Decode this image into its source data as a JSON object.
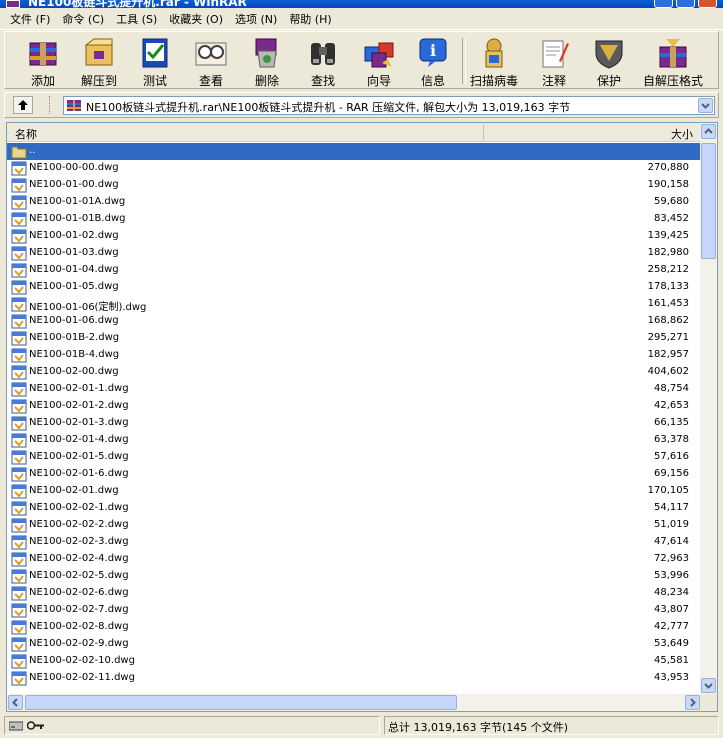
{
  "window": {
    "title": "NE100板链斗式提升机.rar - WinRAR"
  },
  "menu": [
    {
      "label": "文件 (F)"
    },
    {
      "label": "命令 (C)"
    },
    {
      "label": "工具 (S)"
    },
    {
      "label": "收藏夹 (O)"
    },
    {
      "label": "选项 (N)"
    },
    {
      "label": "帮助 (H)"
    }
  ],
  "toolbar": [
    {
      "label": "添加",
      "icon": "add-archive-icon"
    },
    {
      "label": "解压到",
      "icon": "extract-to-icon"
    },
    {
      "label": "测试",
      "icon": "test-icon"
    },
    {
      "label": "查看",
      "icon": "view-icon"
    },
    {
      "label": "删除",
      "icon": "delete-icon"
    },
    {
      "label": "查找",
      "icon": "find-icon"
    },
    {
      "label": "向导",
      "icon": "wizard-icon"
    },
    {
      "label": "信息",
      "icon": "info-icon"
    },
    {
      "label": "扫描病毒",
      "icon": "virus-scan-icon"
    },
    {
      "label": "注释",
      "icon": "comment-icon"
    },
    {
      "label": "保护",
      "icon": "protect-icon"
    },
    {
      "label": "自解压格式",
      "icon": "sfx-icon"
    }
  ],
  "address": {
    "path": "NE100板链斗式提升机.rar\\NE100板链斗式提升机 - RAR 压缩文件, 解包大小为 13,019,163 字节"
  },
  "columns": {
    "name": "名称",
    "size": "大小"
  },
  "parent_row": {
    "name": ".."
  },
  "files": [
    {
      "name": "NE100-00-00.dwg",
      "size": "270,880"
    },
    {
      "name": "NE100-01-00.dwg",
      "size": "190,158"
    },
    {
      "name": "NE100-01-01A.dwg",
      "size": "59,680"
    },
    {
      "name": "NE100-01-01B.dwg",
      "size": "83,452"
    },
    {
      "name": "NE100-01-02.dwg",
      "size": "139,425"
    },
    {
      "name": "NE100-01-03.dwg",
      "size": "182,980"
    },
    {
      "name": "NE100-01-04.dwg",
      "size": "258,212"
    },
    {
      "name": "NE100-01-05.dwg",
      "size": "178,133"
    },
    {
      "name": "NE100-01-06(定制).dwg",
      "size": "161,453"
    },
    {
      "name": "NE100-01-06.dwg",
      "size": "168,862"
    },
    {
      "name": "NE100-01B-2.dwg",
      "size": "295,271"
    },
    {
      "name": "NE100-01B-4.dwg",
      "size": "182,957"
    },
    {
      "name": "NE100-02-00.dwg",
      "size": "404,602"
    },
    {
      "name": "NE100-02-01-1.dwg",
      "size": "48,754"
    },
    {
      "name": "NE100-02-01-2.dwg",
      "size": "42,653"
    },
    {
      "name": "NE100-02-01-3.dwg",
      "size": "66,135"
    },
    {
      "name": "NE100-02-01-4.dwg",
      "size": "63,378"
    },
    {
      "name": "NE100-02-01-5.dwg",
      "size": "57,616"
    },
    {
      "name": "NE100-02-01-6.dwg",
      "size": "69,156"
    },
    {
      "name": "NE100-02-01.dwg",
      "size": "170,105"
    },
    {
      "name": "NE100-02-02-1.dwg",
      "size": "54,117"
    },
    {
      "name": "NE100-02-02-2.dwg",
      "size": "51,019"
    },
    {
      "name": "NE100-02-02-3.dwg",
      "size": "47,614"
    },
    {
      "name": "NE100-02-02-4.dwg",
      "size": "72,963"
    },
    {
      "name": "NE100-02-02-5.dwg",
      "size": "53,996"
    },
    {
      "name": "NE100-02-02-6.dwg",
      "size": "48,234"
    },
    {
      "name": "NE100-02-02-7.dwg",
      "size": "43,807"
    },
    {
      "name": "NE100-02-02-8.dwg",
      "size": "42,777"
    },
    {
      "name": "NE100-02-02-9.dwg",
      "size": "53,649"
    },
    {
      "name": "NE100-02-02-10.dwg",
      "size": "45,581"
    },
    {
      "name": "NE100-02-02-11.dwg",
      "size": "43,953"
    }
  ],
  "status": {
    "summary": "总计 13,019,163 字节(145 个文件)"
  },
  "colors": {
    "selection": "#316ac5",
    "titlebar": "#0a5fd8",
    "window_bg": "#ece9d8"
  }
}
